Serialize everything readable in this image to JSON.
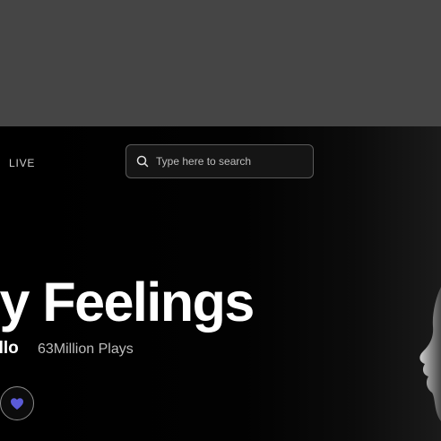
{
  "nav": {
    "live_label": "LIVE"
  },
  "search": {
    "placeholder": "Type here to search",
    "value": ""
  },
  "hero": {
    "title": "ly Feelings",
    "artist": "ello",
    "plays": "63Million Plays"
  },
  "icons": {
    "search": "search-icon",
    "like": "heart-icon"
  },
  "colors": {
    "accent": "#5b5bd6",
    "top_band": "#454545",
    "background": "#000000"
  }
}
